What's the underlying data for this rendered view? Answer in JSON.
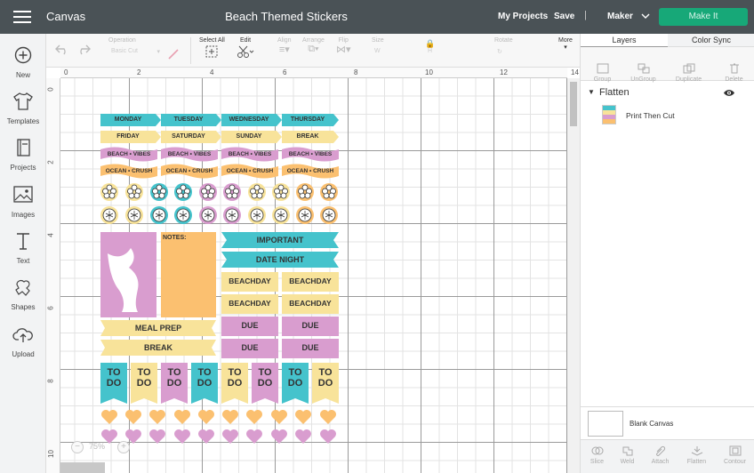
{
  "topbar": {
    "canvas_label": "Canvas",
    "project_title": "Beach Themed Stickers",
    "my_projects": "My Projects",
    "save": "Save",
    "separator": "|",
    "machine": "Maker",
    "make_it": "Make It"
  },
  "sidebar": {
    "items": [
      {
        "label": "New",
        "icon": "plus-circle-icon"
      },
      {
        "label": "Templates",
        "icon": "tshirt-icon"
      },
      {
        "label": "Projects",
        "icon": "book-icon"
      },
      {
        "label": "Images",
        "icon": "image-icon"
      },
      {
        "label": "Text",
        "icon": "text-icon"
      },
      {
        "label": "Shapes",
        "icon": "shapes-icon"
      },
      {
        "label": "Upload",
        "icon": "cloud-upload-icon"
      }
    ]
  },
  "toolbar": {
    "operation_label": "Operation",
    "operation_value": "Basic Cut",
    "select_all": "Select All",
    "edit": "Edit",
    "align": "Align",
    "arrange": "Arrange",
    "flip": "Flip",
    "size": "Size",
    "size_w": "W",
    "size_h": "H",
    "rotate": "Rotate",
    "more": "More"
  },
  "ruler": {
    "h": [
      "0",
      "2",
      "4",
      "6",
      "8",
      "10",
      "12",
      "14"
    ],
    "v": [
      "0",
      "2",
      "4",
      "6",
      "8",
      "10"
    ]
  },
  "zoom": {
    "minus": "−",
    "value": "75%",
    "plus": "+"
  },
  "panel": {
    "tabs": [
      "Layers",
      "Color Sync"
    ],
    "tools": [
      "Group",
      "UnGroup",
      "Duplicate",
      "Delete"
    ],
    "group_name": "Flatten",
    "layer_name": "Print Then Cut",
    "blank_canvas": "Blank Canvas",
    "bottom_tools": [
      "Slice",
      "Weld",
      "Attach",
      "Flatten",
      "Contour"
    ]
  },
  "colors": {
    "teal": "#45c3cc",
    "yellow": "#f8e39a",
    "pink": "#d99dcf",
    "peach": "#fbc070",
    "topbar": "#4a5256",
    "make": "#17a878"
  },
  "stickers": {
    "days": [
      "MONDAY",
      "TUESDAY",
      "WEDNESDAY",
      "THURSDAY",
      "FRIDAY",
      "SATURDAY",
      "SUNDAY",
      "BREAK"
    ],
    "beach": "BEACH • VIBES",
    "ocean": "OCEAN • CRUSH",
    "notes": "NOTES:",
    "important": "IMPORTANT",
    "datenight": "DATE NIGHT",
    "beachday": "BEACHDAY",
    "due": "DUE",
    "mealprep": "MEAL PREP",
    "break": "BREAK",
    "todo_top": "TO",
    "todo_bottom": "DO"
  }
}
